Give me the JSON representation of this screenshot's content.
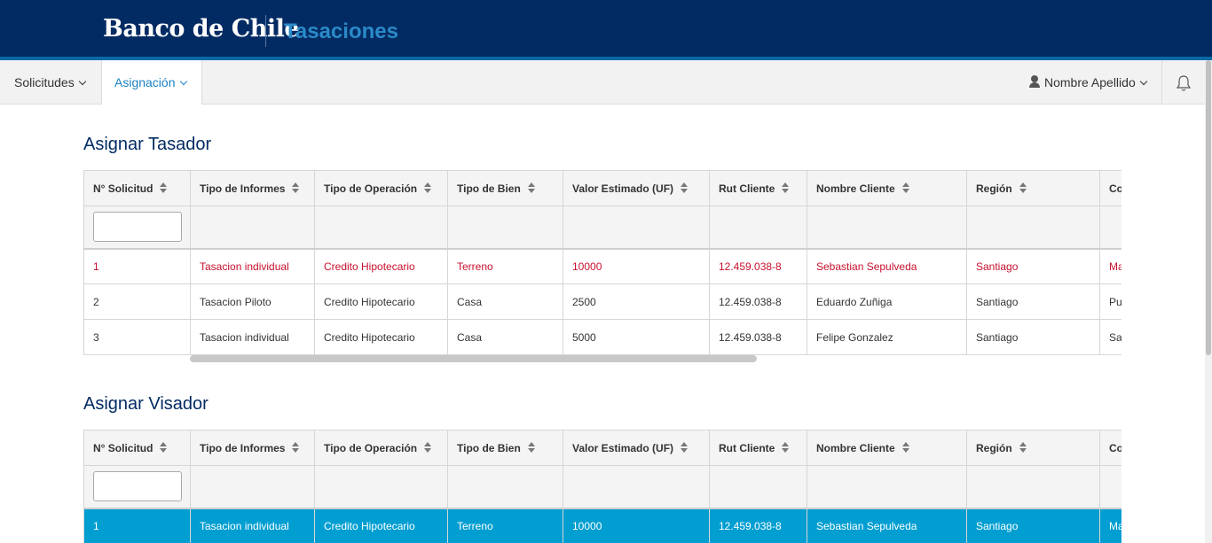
{
  "header": {
    "logo": "Banco de Chile",
    "app_title": "Tasaciones"
  },
  "nav": {
    "items": [
      {
        "label": "Solicitudes"
      },
      {
        "label": "Asignación"
      }
    ],
    "user_name": "Nombre Apellido"
  },
  "columns": [
    "N° Solicitud",
    "Tipo de Informes",
    "Tipo de Operación",
    "Tipo de Bien",
    "Valor Estimado (UF)",
    "Rut Cliente",
    "Nombre Cliente",
    "Región",
    "Co"
  ],
  "sections": [
    {
      "title": "Asignar Tasador",
      "rows": [
        [
          "1",
          "Tasacion individual",
          "Credito Hipotecario",
          "Terreno",
          "10000",
          "12.459.038-8",
          "Sebastian Sepulveda",
          "Santiago",
          "Ma"
        ],
        [
          "2",
          "Tasacion Piloto",
          "Credito Hipotecario",
          "Casa",
          "2500",
          "12.459.038-8",
          "Eduardo Zuñiga",
          "Santiago",
          "Pu"
        ],
        [
          "3",
          "Tasacion individual",
          "Credito Hipotecario",
          "Casa",
          "5000",
          "12.459.038-8",
          "Felipe Gonzalez",
          "Santiago",
          "Sa"
        ]
      ]
    },
    {
      "title": "Asignar Visador",
      "rows": [
        [
          "1",
          "Tasacion individual",
          "Credito Hipotecario",
          "Terreno",
          "10000",
          "12.459.038-8",
          "Sebastian Sepulveda",
          "Santiago",
          "Ma"
        ]
      ]
    }
  ],
  "colors": {
    "header_bg": "#032b63",
    "accent": "#1a82c4",
    "highlight_text": "#c8102e",
    "selected_row": "#009ed1"
  }
}
